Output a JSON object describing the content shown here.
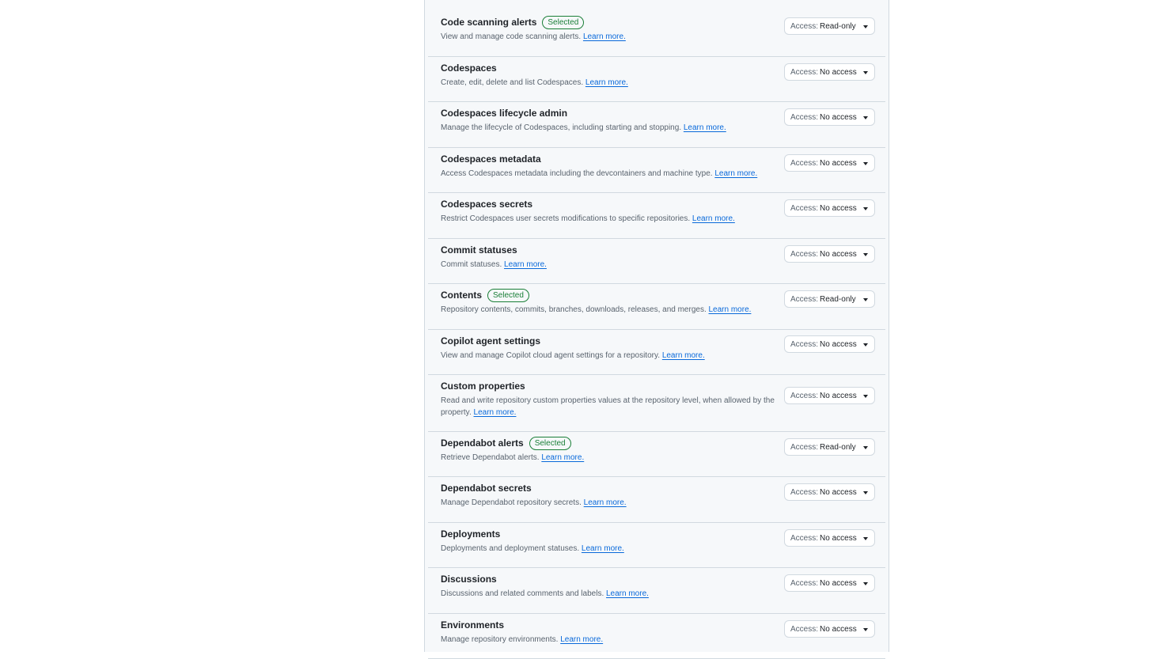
{
  "labels": {
    "access_prefix": "Access:",
    "learn_more": "Learn more.",
    "selected_badge": "Selected"
  },
  "permissions": [
    {
      "title": "Code scanning alerts",
      "selected": true,
      "description": "View and manage code scanning alerts.",
      "access": "Read-only"
    },
    {
      "title": "Codespaces",
      "selected": false,
      "description": "Create, edit, delete and list Codespaces.",
      "access": "No access"
    },
    {
      "title": "Codespaces lifecycle admin",
      "selected": false,
      "description": "Manage the lifecycle of Codespaces, including starting and stopping.",
      "access": "No access"
    },
    {
      "title": "Codespaces metadata",
      "selected": false,
      "description": "Access Codespaces metadata including the devcontainers and machine type.",
      "access": "No access"
    },
    {
      "title": "Codespaces secrets",
      "selected": false,
      "description": "Restrict Codespaces user secrets modifications to specific repositories.",
      "access": "No access"
    },
    {
      "title": "Commit statuses",
      "selected": false,
      "description": "Commit statuses.",
      "access": "No access"
    },
    {
      "title": "Contents",
      "selected": true,
      "description": "Repository contents, commits, branches, downloads, releases, and merges.",
      "access": "Read-only"
    },
    {
      "title": "Copilot agent settings",
      "selected": false,
      "description": "View and manage Copilot cloud agent settings for a repository.",
      "access": "No access"
    },
    {
      "title": "Custom properties",
      "selected": false,
      "description": "Read and write repository custom properties values at the repository level, when allowed by the property.",
      "access": "No access"
    },
    {
      "title": "Dependabot alerts",
      "selected": true,
      "description": "Retrieve Dependabot alerts.",
      "access": "Read-only"
    },
    {
      "title": "Dependabot secrets",
      "selected": false,
      "description": "Manage Dependabot repository secrets.",
      "access": "No access"
    },
    {
      "title": "Deployments",
      "selected": false,
      "description": "Deployments and deployment statuses.",
      "access": "No access"
    },
    {
      "title": "Discussions",
      "selected": false,
      "description": "Discussions and related comments and labels.",
      "access": "No access"
    },
    {
      "title": "Environments",
      "selected": false,
      "description": "Manage repository environments.",
      "access": "No access"
    }
  ]
}
